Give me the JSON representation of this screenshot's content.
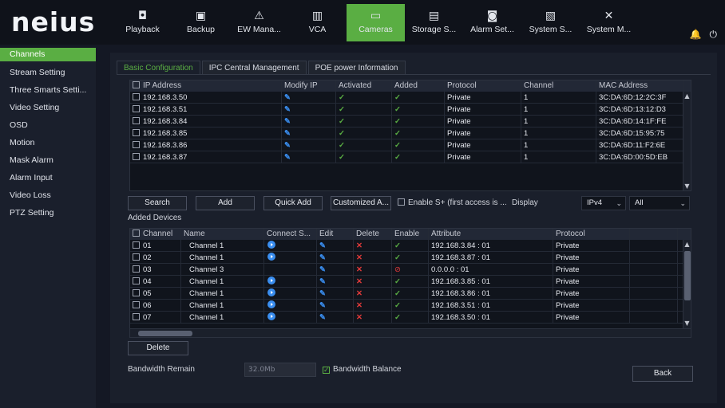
{
  "brand": {
    "logo": "neius"
  },
  "nav": [
    {
      "label": "Playback",
      "icon": "playback-icon",
      "glyph": "◘"
    },
    {
      "label": "Backup",
      "icon": "save-icon",
      "glyph": "▣"
    },
    {
      "label": "EW Mana...",
      "icon": "warning-icon",
      "glyph": "⚠"
    },
    {
      "label": "VCA",
      "icon": "analytics-icon",
      "glyph": "▥"
    },
    {
      "label": "Cameras",
      "icon": "camera-icon",
      "glyph": "▭",
      "active": true
    },
    {
      "label": "Storage S...",
      "icon": "storage-icon",
      "glyph": "▤"
    },
    {
      "label": "Alarm Set...",
      "icon": "alarm-icon",
      "glyph": "◙"
    },
    {
      "label": "System S...",
      "icon": "system-settings-icon",
      "glyph": "▧"
    },
    {
      "label": "System M...",
      "icon": "tools-icon",
      "glyph": "✕"
    }
  ],
  "topright": {
    "bell_glyph": "🔔",
    "power_glyph": "⏻"
  },
  "sidebar": {
    "items": [
      {
        "label": "Channels",
        "active": true
      },
      {
        "label": "Stream Setting"
      },
      {
        "label": "Three Smarts Setti..."
      },
      {
        "label": "Video Setting"
      },
      {
        "label": "OSD"
      },
      {
        "label": "Motion"
      },
      {
        "label": "Mask Alarm"
      },
      {
        "label": "Alarm Input"
      },
      {
        "label": "Video Loss"
      },
      {
        "label": "PTZ Setting"
      }
    ]
  },
  "tabs": [
    {
      "label": "Basic Configuration",
      "active": true
    },
    {
      "label": "IPC Central Management"
    },
    {
      "label": "POE power Information"
    }
  ],
  "search_table": {
    "headers": [
      "IP Address",
      "Modify IP",
      "Activated",
      "Added",
      "Protocol",
      "Channel",
      "MAC Address"
    ],
    "rows": [
      {
        "ip": "192.168.3.50",
        "protocol": "Private",
        "channel": "1",
        "mac": "3C:DA:6D:12:2C:3F"
      },
      {
        "ip": "192.168.3.51",
        "protocol": "Private",
        "channel": "1",
        "mac": "3C:DA:6D:13:12:D3"
      },
      {
        "ip": "192.168.3.84",
        "protocol": "Private",
        "channel": "1",
        "mac": "3C:DA:6D:14:1F:FE"
      },
      {
        "ip": "192.168.3.85",
        "protocol": "Private",
        "channel": "1",
        "mac": "3C:DA:6D:15:95:75"
      },
      {
        "ip": "192.168.3.86",
        "protocol": "Private",
        "channel": "1",
        "mac": "3C:DA:6D:11:F2:6E"
      },
      {
        "ip": "192.168.3.87",
        "protocol": "Private",
        "channel": "1",
        "mac": "3C:DA:6D:00:5D:EB"
      }
    ]
  },
  "buttons": {
    "search": "Search",
    "add": "Add",
    "quick_add": "Quick Add",
    "customized_add": "Customized A...",
    "enable_s_plus": "Enable S+ (first access is ...",
    "display": "Display",
    "delete": "Delete",
    "back": "Back"
  },
  "display_filters": {
    "protocol": "IPv4",
    "scope": "All"
  },
  "added_devices": {
    "title": "Added Devices",
    "headers": [
      "Channel",
      "Name",
      "Connect S...",
      "Edit",
      "Delete",
      "Enable",
      "Attribute",
      "Protocol"
    ],
    "rows": [
      {
        "channel": "01",
        "name": "Channel 1",
        "connected": true,
        "enabled": true,
        "attribute": "192.168.3.84 : 01",
        "protocol": "Private"
      },
      {
        "channel": "02",
        "name": "Channel 1",
        "connected": true,
        "enabled": true,
        "attribute": "192.168.3.87 : 01",
        "protocol": "Private"
      },
      {
        "channel": "03",
        "name": "Channel 3",
        "connected": false,
        "enabled": false,
        "attribute": "0.0.0.0 : 01",
        "protocol": "Private"
      },
      {
        "channel": "04",
        "name": "Channel 1",
        "connected": true,
        "enabled": true,
        "attribute": "192.168.3.85 : 01",
        "protocol": "Private"
      },
      {
        "channel": "05",
        "name": "Channel 1",
        "connected": true,
        "enabled": true,
        "attribute": "192.168.3.86 : 01",
        "protocol": "Private"
      },
      {
        "channel": "06",
        "name": "Channel 1",
        "connected": true,
        "enabled": true,
        "attribute": "192.168.3.51 : 01",
        "protocol": "Private"
      },
      {
        "channel": "07",
        "name": "Channel 1",
        "connected": true,
        "enabled": true,
        "attribute": "192.168.3.50 : 01",
        "protocol": "Private"
      }
    ]
  },
  "bandwidth": {
    "remain_label": "Bandwidth Remain",
    "remain_value": "32.0Mb",
    "balance_label": "Bandwidth Balance",
    "balance_checked": true
  },
  "colors": {
    "accent": "#5aae43",
    "edit_blue": "#3a8ef0",
    "delete_red": "#e23a3a"
  }
}
